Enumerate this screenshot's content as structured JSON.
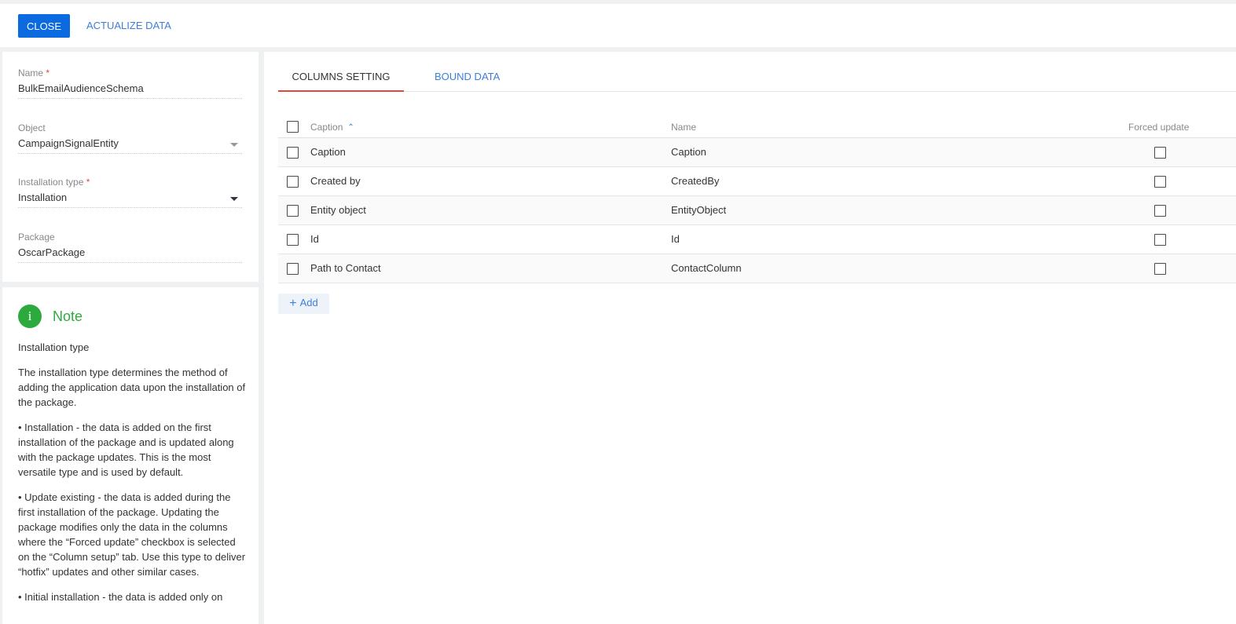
{
  "toolbar": {
    "close_label": "CLOSE",
    "actualize_label": "ACTUALIZE DATA"
  },
  "fields": {
    "name": {
      "label": "Name",
      "required_mark": "*",
      "value": "BulkEmailAudienceSchema"
    },
    "object": {
      "label": "Object",
      "value": "CampaignSignalEntity"
    },
    "installation_type": {
      "label": "Installation type",
      "required_mark": "*",
      "value": "Installation"
    },
    "package": {
      "label": "Package",
      "value": "OscarPackage"
    }
  },
  "note": {
    "icon": "i",
    "title": "Note",
    "paragraphs": [
      "Installation type",
      "The installation type determines the method of adding the application data upon the installation of the package.",
      "• Installation - the data is added on the first installation of the package and is updated along with the package updates. This is the most versatile type and is used by default.",
      "• Update existing - the data is added during the first installation of the package. Updating the package modifies only the data in the columns where the “Forced update” checkbox is selected on the “Column setup” tab. Use this type to deliver “hotfix” updates and other similar cases.",
      "• Initial installation - the data is added only on"
    ]
  },
  "tabs": {
    "columns_setting": "COLUMNS SETTING",
    "bound_data": "BOUND DATA"
  },
  "grid": {
    "headers": {
      "caption": "Caption",
      "name": "Name",
      "forced": "Forced update"
    },
    "rows": [
      {
        "caption": "Caption",
        "name": "Caption"
      },
      {
        "caption": "Created by",
        "name": "CreatedBy"
      },
      {
        "caption": "Entity object",
        "name": "EntityObject"
      },
      {
        "caption": "Id",
        "name": "Id"
      },
      {
        "caption": "Path to Contact",
        "name": "ContactColumn"
      }
    ]
  },
  "add_button": {
    "label": "Add"
  },
  "colors": {
    "primary": "#0b6ae0",
    "link": "#3d7ed8",
    "required": "#e4463c",
    "note_green": "#2daa3d"
  }
}
